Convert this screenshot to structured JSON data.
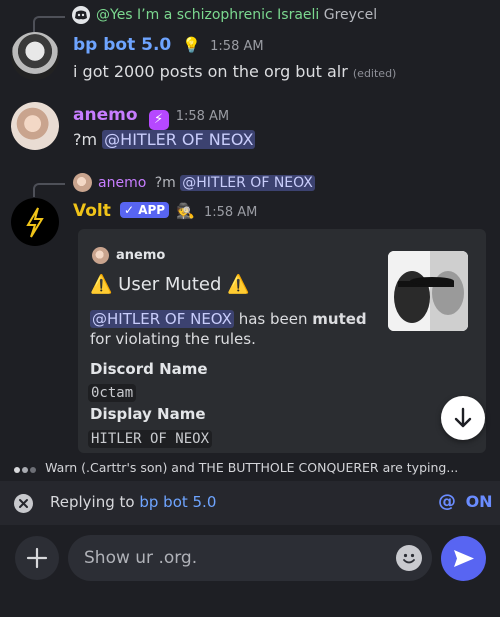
{
  "messages": {
    "m1": {
      "reply_mention": "@Yes I’m a schizophrenic Israeli",
      "reply_text": "Greycel",
      "author": "bp bot 5.0",
      "time": "1:58 AM",
      "text": "i got 2000 posts on the org but alr",
      "edited": "(edited)"
    },
    "m2": {
      "author": "anemo",
      "time": "1:58 AM",
      "prefix": "?m",
      "mention": "@HITLER OF NEOX"
    },
    "m3": {
      "reply_author": "anemo",
      "reply_prefix": "?m",
      "reply_mention": "@HITLER OF NEOX",
      "author": "Volt",
      "app_badge": "✓ APP",
      "time": "1:58 AM",
      "embed": {
        "author": "anemo",
        "title": "User Muted",
        "warn_icon": "⚠️",
        "desc_mention": "@HITLER OF NEOX",
        "desc_part1": "has been",
        "desc_bold": "muted",
        "desc_part2": "for violating the rules.",
        "field1_name": "Discord Name",
        "field1_value": "0ctam",
        "field2_name": "Display Name",
        "field2_value": "HITLER OF NEOX"
      }
    }
  },
  "typing": "Warn (.Carttr's son) and THE BUTTHOLE CONQUERER are typing...",
  "replying": {
    "prefix": "Replying to",
    "target": "bp bot 5.0",
    "at": "@",
    "toggle": "ON"
  },
  "composer": {
    "placeholder": "Show ur .org."
  },
  "colors": {
    "bg": "#1e1f24",
    "accent": "#5865f2",
    "volt_yellow": "#f0c419",
    "anemo_purple": "#c77dff",
    "bp_blue": "#6ea4ff"
  }
}
